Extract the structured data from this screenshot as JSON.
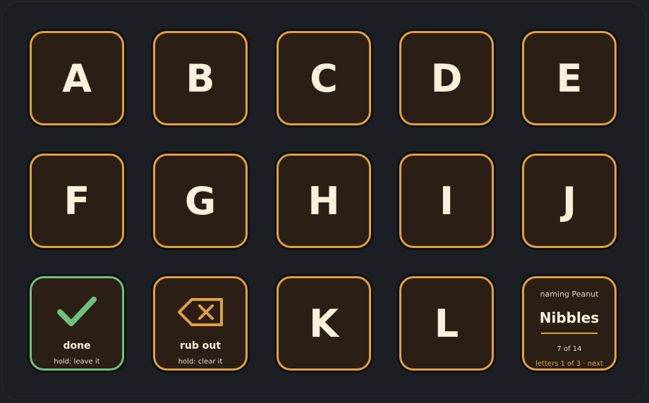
{
  "letters": [
    "A",
    "B",
    "C",
    "D",
    "E",
    "F",
    "G",
    "H",
    "I",
    "J",
    "K",
    "L"
  ],
  "done_key": {
    "label": "done",
    "hint": "hold: leave it",
    "icon": "check-icon",
    "color": "#6dc27a"
  },
  "rub_out_key": {
    "label": "rub out",
    "hint": "hold: clear it",
    "icon": "backspace-icon"
  },
  "status": {
    "naming": "naming Peanut",
    "name": "Nibbles",
    "count": "7 of 14",
    "paging": "letters 1 of 3 · next"
  },
  "colors": {
    "key_background": "#2b1e15",
    "key_border": "#e2a13a",
    "letter_text": "#fbf0db",
    "deck_background": "#1b1f24"
  }
}
